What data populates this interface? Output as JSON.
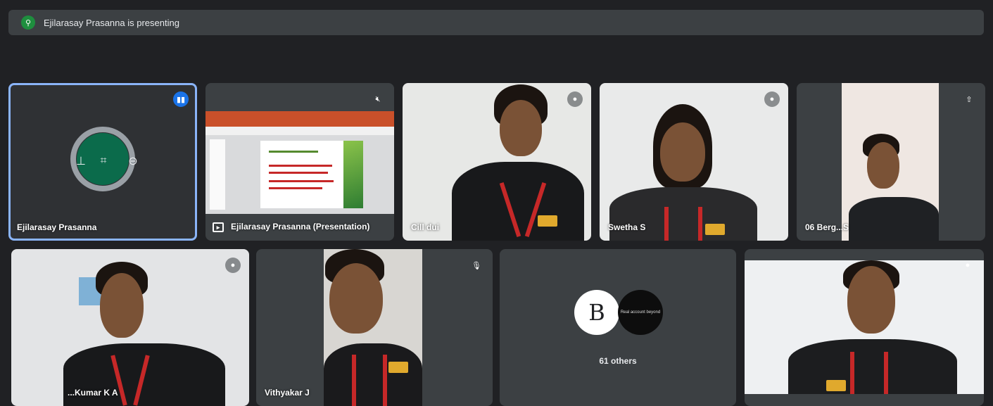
{
  "banner": {
    "text": "Ejilarasay Prasanna is presenting",
    "icon": "pin-icon"
  },
  "tiles": [
    {
      "name": "Ejilarasay Prasanna",
      "status": "speaking",
      "controls": [
        "pin-icon",
        "fullscreen-icon",
        "remove-icon"
      ]
    },
    {
      "name": "Ejilarasay Prasanna (Presentation)",
      "status": "muted"
    },
    {
      "name": "Cill dui",
      "status": "muted"
    },
    {
      "name": "Swetha S",
      "status": "muted"
    },
    {
      "name": "06 Berg...S",
      "status": "muted"
    },
    {
      "name": "...Kumar K A",
      "status": "muted"
    },
    {
      "name": "Vithyakar J",
      "status": "muted"
    },
    {
      "name": "61 others",
      "avatar_letter": "B",
      "avatar_text": "Real account beyond",
      "status": "none"
    },
    {
      "name": "",
      "status": "muted"
    }
  ],
  "colors": {
    "background": "#202124",
    "tile": "#3c4043",
    "active_outline": "#8ab4f8",
    "speaking": "#1a73e8"
  }
}
